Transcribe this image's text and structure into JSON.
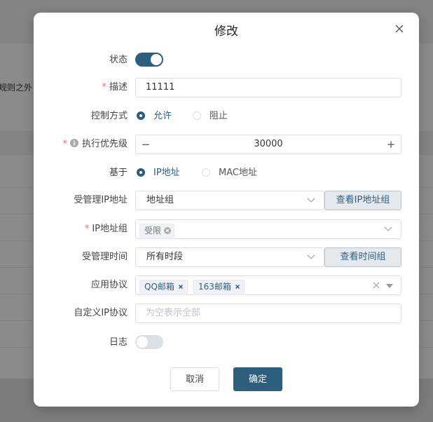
{
  "background": {
    "text": "规则之外"
  },
  "modal": {
    "title": "修改",
    "close_icon": "close-icon"
  },
  "form": {
    "status": {
      "label": "状态",
      "on": true
    },
    "description": {
      "label": "描述",
      "value": "11111"
    },
    "control_mode": {
      "label": "控制方式",
      "options": [
        "允许",
        "阻止"
      ],
      "selected": "允许"
    },
    "priority": {
      "label": "执行优先级",
      "value": "30000",
      "minus": "−",
      "plus": "+"
    },
    "based_on": {
      "label": "基于",
      "options": [
        "IP地址",
        "MAC地址"
      ],
      "selected": "IP地址"
    },
    "managed_ip": {
      "label": "受管理IP地址",
      "value": "地址组",
      "button": "查看IP地址组"
    },
    "ip_group": {
      "label": "IP地址组",
      "tags": [
        "受限"
      ]
    },
    "managed_time": {
      "label": "受管理时间",
      "value": "所有时段",
      "button": "查看时间组"
    },
    "app_protocol": {
      "label": "应用协议",
      "tags": [
        "QQ邮箱",
        "163邮箱"
      ]
    },
    "custom_ip_protocol": {
      "label": "自定义IP协议",
      "placeholder": "为空表示全部"
    },
    "log": {
      "label": "日志",
      "on": false
    }
  },
  "footer": {
    "cancel_label": "取消",
    "ok_label": "确定"
  },
  "colors": {
    "accent": "#2e5e7e",
    "required": "#f56c6c",
    "border": "#dcdfe6"
  }
}
